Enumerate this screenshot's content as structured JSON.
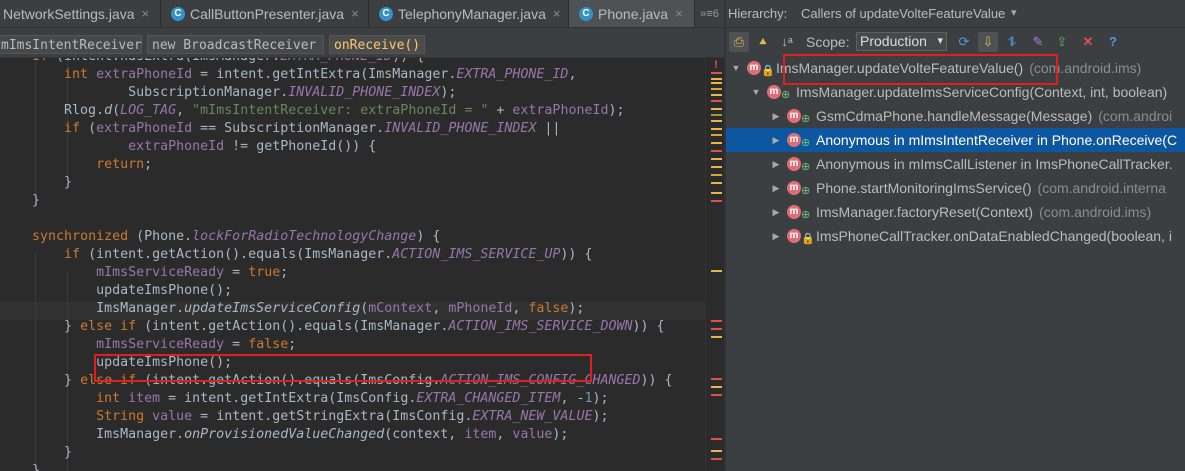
{
  "tabs": [
    {
      "label": "NetworkSettings.java",
      "icon": "class-icon",
      "close": "×"
    },
    {
      "label": "CallButtonPresenter.java",
      "icon": "class-icon",
      "close": "×"
    },
    {
      "label": "TelephonyManager.java",
      "icon": "class-icon",
      "close": "×"
    },
    {
      "label": "Phone.java",
      "icon": "class-icon",
      "close": "×"
    }
  ],
  "tab_overflow": "»≡6",
  "breadcrumb": [
    "mImsIntentReceiver",
    "new BroadcastReceiver",
    "onReceive()"
  ],
  "code_lines": [
    [
      "    if (intent.hasExtra(ImsManager.EXTRA_PHONE_ID)) {"
    ],
    [
      "        int extraPhoneId = intent.getIntExtra(ImsManager.EXTRA_PHONE_ID,"
    ],
    [
      "                SubscriptionManager.INVALID_PHONE_INDEX);"
    ],
    [
      "        Rlog.d(LOG_TAG, \"mImsIntentReceiver: extraPhoneId = \" + extraPhoneId);"
    ],
    [
      "        if (extraPhoneId == SubscriptionManager.INVALID_PHONE_INDEX ||"
    ],
    [
      "                extraPhoneId != getPhoneId()) {"
    ],
    [
      "            return;"
    ],
    [
      "        }"
    ],
    [
      "    }"
    ],
    [
      ""
    ],
    [
      "    synchronized (Phone.lockForRadioTechnologyChange) {"
    ],
    [
      "        if (intent.getAction().equals(ImsManager.ACTION_IMS_SERVICE_UP)) {"
    ],
    [
      "            mImsServiceReady = true;"
    ],
    [
      "            updateImsPhone();"
    ],
    [
      "            ImsManager.updateImsServiceConfig(mContext, mPhoneId, false);"
    ],
    [
      "        } else if (intent.getAction().equals(ImsManager.ACTION_IMS_SERVICE_DOWN)) {"
    ],
    [
      "            mImsServiceReady = false;"
    ],
    [
      "            updateImsPhone();"
    ],
    [
      "        } else if (intent.getAction().equals(ImsConfig.ACTION_IMS_CONFIG_CHANGED)) {"
    ],
    [
      "            int item = intent.getIntExtra(ImsConfig.EXTRA_CHANGED_ITEM, -1);"
    ],
    [
      "            String value = intent.getStringExtra(ImsConfig.EXTRA_NEW_VALUE);"
    ],
    [
      "            ImsManager.onProvisionedValueChanged(context, item, value);"
    ],
    [
      "        }"
    ],
    [
      "    }"
    ]
  ],
  "hierarchy": {
    "label": "Hierarchy:",
    "title": "Callers of updateVolteFeatureValue",
    "dropdown": "▾",
    "scope_label": "Scope:",
    "scope_value": "Production",
    "scope_arrow": "▾",
    "tools": [
      "pin-tab-icon",
      "caller-hierarchy-icon",
      "sort-alpha-icon",
      "refresh-icon",
      "autoscroll-icon",
      "expand-all-icon",
      "export-icon",
      "close-icon",
      "help-icon"
    ],
    "tool_glyphs": [
      "⎙",
      "⯅",
      "↓ᵃ",
      "⟳",
      "⇩",
      "⥮",
      "⇪",
      "✕",
      "?"
    ],
    "rows": [
      {
        "method": "ImsManager.updateVolteFeatureValue()",
        "pkg": "(com.android.ims)",
        "expanded": true,
        "level": 0
      },
      {
        "method": "ImsManager.updateImsServiceConfig(Context, int, boolean)",
        "pkg": "",
        "expanded": true,
        "level": 1
      },
      {
        "method": "GsmCdmaPhone.handleMessage(Message)",
        "pkg": "(com.androi",
        "expanded": false,
        "level": 2
      },
      {
        "method": "Anonymous in mImsIntentReceiver in Phone.onReceive(C",
        "pkg": "",
        "expanded": false,
        "level": 2,
        "selected": true
      },
      {
        "method": "Anonymous in mImsCallListener in ImsPhoneCallTracker.",
        "pkg": "",
        "expanded": false,
        "level": 2
      },
      {
        "method": "Phone.startMonitoringImsService()",
        "pkg": "(com.android.interna",
        "expanded": false,
        "level": 2
      },
      {
        "method": "ImsManager.factoryReset(Context)",
        "pkg": "(com.android.ims)",
        "expanded": false,
        "level": 2
      },
      {
        "method": "ImsPhoneCallTracker.onDataEnabledChanged(boolean, i",
        "pkg": "",
        "expanded": false,
        "level": 2
      }
    ]
  },
  "colors": {
    "editor_bg": "#2b2b2b",
    "keyword": "#cc7832",
    "field": "#9876aa",
    "string": "#6a8759",
    "number": "#6897bb",
    "selection": "#0d57a1",
    "annotation_red": "#e0201e"
  }
}
